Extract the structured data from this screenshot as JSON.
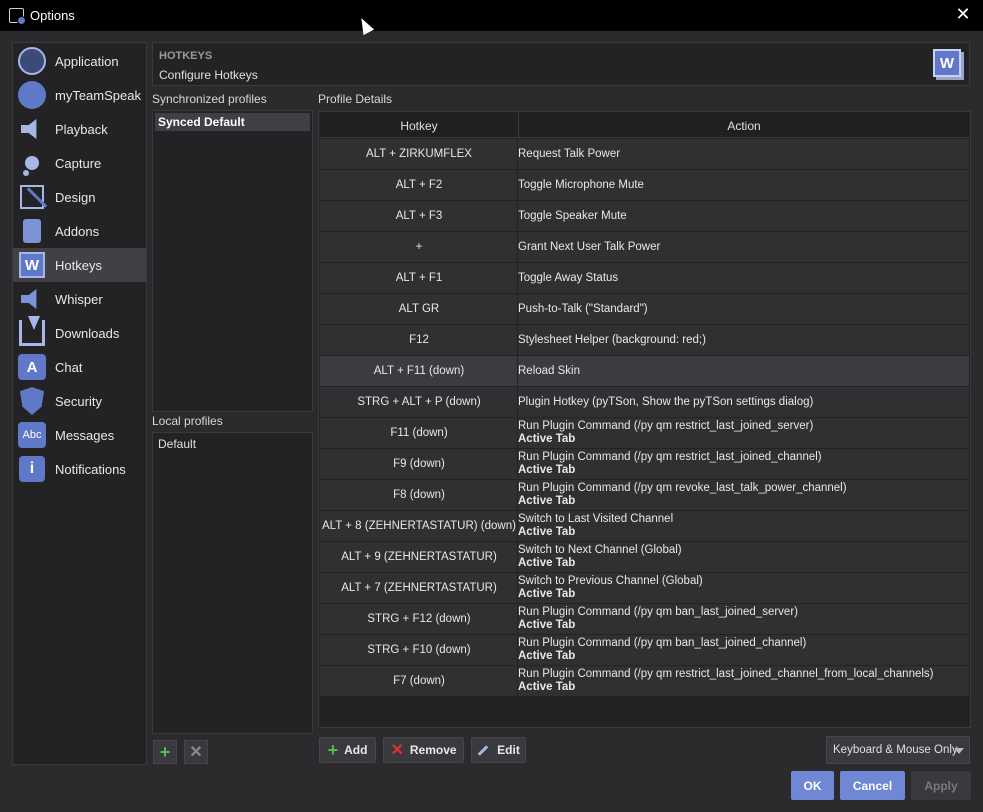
{
  "window": {
    "title": "Options"
  },
  "sidebar": {
    "items": [
      {
        "label": "Application",
        "icon": "application-icon"
      },
      {
        "label": "myTeamSpeak",
        "icon": "myteamspeak-icon"
      },
      {
        "label": "Playback",
        "icon": "speaker-icon"
      },
      {
        "label": "Capture",
        "icon": "microphone-icon"
      },
      {
        "label": "Design",
        "icon": "design-icon"
      },
      {
        "label": "Addons",
        "icon": "puzzle-icon"
      },
      {
        "label": "Hotkeys",
        "icon": "hotkeys-icon",
        "active": true
      },
      {
        "label": "Whisper",
        "icon": "whisper-icon"
      },
      {
        "label": "Downloads",
        "icon": "download-icon"
      },
      {
        "label": "Chat",
        "icon": "chat-icon"
      },
      {
        "label": "Security",
        "icon": "shield-icon"
      },
      {
        "label": "Messages",
        "icon": "messages-icon"
      },
      {
        "label": "Notifications",
        "icon": "info-icon"
      }
    ]
  },
  "header": {
    "category": "HOTKEYS",
    "subtitle": "Configure Hotkeys",
    "icon_letter": "W"
  },
  "profiles": {
    "synced_label": "Synchronized profiles",
    "synced": [
      "Synced Default"
    ],
    "local_label": "Local profiles",
    "local": [
      "Default"
    ]
  },
  "details": {
    "label": "Profile Details",
    "columns": [
      "Hotkey",
      "Action"
    ],
    "rows": [
      {
        "hotkey": "ALT + ZIRKUMFLEX",
        "action": "Request Talk Power",
        "tab": ""
      },
      {
        "hotkey": "ALT + F2",
        "action": "Toggle Microphone Mute",
        "tab": ""
      },
      {
        "hotkey": "ALT + F3",
        "action": "Toggle Speaker Mute",
        "tab": ""
      },
      {
        "hotkey": "+",
        "action": "Grant Next User Talk Power",
        "tab": ""
      },
      {
        "hotkey": "ALT + F1",
        "action": "Toggle Away Status",
        "tab": ""
      },
      {
        "hotkey": "ALT GR",
        "action": "Push-to-Talk (\"Standard\")",
        "tab": ""
      },
      {
        "hotkey": "F12",
        "action": "Stylesheet Helper (background: red;)",
        "tab": ""
      },
      {
        "hotkey": "ALT + F11 (down)",
        "action": "Reload Skin",
        "tab": "",
        "highlight": true
      },
      {
        "hotkey": "STRG + ALT + P (down)",
        "action": "Plugin Hotkey (pyTSon, Show the pyTSon settings dialog)",
        "tab": ""
      },
      {
        "hotkey": "F11 (down)",
        "action": "Run Plugin Command (/py qm restrict_last_joined_server)",
        "tab": "Active Tab"
      },
      {
        "hotkey": "F9 (down)",
        "action": "Run Plugin Command (/py qm restrict_last_joined_channel)",
        "tab": "Active Tab"
      },
      {
        "hotkey": "F8 (down)",
        "action": "Run Plugin Command (/py qm revoke_last_talk_power_channel)",
        "tab": "Active Tab"
      },
      {
        "hotkey": "ALT + 8 (ZEHNERTASTATUR) (down)",
        "action": "Switch to Last Visited Channel",
        "tab": "Active Tab"
      },
      {
        "hotkey": "ALT + 9 (ZEHNERTASTATUR)",
        "action": "Switch to Next Channel (Global)",
        "tab": "Active Tab"
      },
      {
        "hotkey": "ALT + 7 (ZEHNERTASTATUR)",
        "action": "Switch to Previous Channel (Global)",
        "tab": "Active Tab"
      },
      {
        "hotkey": "STRG + F12 (down)",
        "action": "Run Plugin Command (/py qm ban_last_joined_server)",
        "tab": "Active Tab"
      },
      {
        "hotkey": "STRG + F10 (down)",
        "action": "Run Plugin Command (/py qm ban_last_joined_channel)",
        "tab": "Active Tab"
      },
      {
        "hotkey": "F7 (down)",
        "action": "Run Plugin Command (/py qm restrict_last_joined_channel_from_local_channels)",
        "tab": "Active Tab"
      }
    ]
  },
  "actions": {
    "add": "Add",
    "remove": "Remove",
    "edit": "Edit"
  },
  "input_mode": {
    "selected": "Keyboard & Mouse Only"
  },
  "dialog": {
    "ok": "OK",
    "cancel": "Cancel",
    "apply": "Apply"
  },
  "colors": {
    "accent": "#6f87d4",
    "icon_blue": "#5f79c8",
    "add_green": "#4fc04f",
    "remove_red": "#e03030"
  }
}
